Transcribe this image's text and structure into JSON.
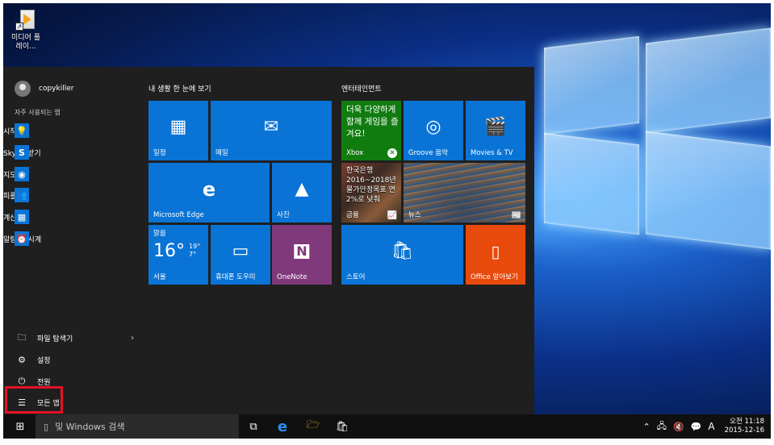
{
  "desktop": {
    "icon_label": "미디어 플레이..."
  },
  "start": {
    "user": "copykiller",
    "frequent_label": "자주 사용되는 앱",
    "apps": [
      {
        "icon": "bulb-icon",
        "label": "시작"
      },
      {
        "icon": "skype-icon",
        "label": "Skype 받기"
      },
      {
        "icon": "maps-icon",
        "label": "지도"
      },
      {
        "icon": "people-icon",
        "label": "피플"
      },
      {
        "icon": "calculator-icon",
        "label": "계산기"
      },
      {
        "icon": "alarm-icon",
        "label": "알람 및 시계"
      }
    ],
    "bottom": [
      {
        "icon": "folder-icon",
        "label": "파일 탐색기"
      },
      {
        "icon": "gear-icon",
        "label": "설정"
      },
      {
        "icon": "power-icon",
        "label": "전원"
      },
      {
        "icon": "all-apps-icon",
        "label": "모든 앱"
      }
    ],
    "group_life": "내 생활 한 눈에 보기",
    "group_ent": "엔터테인먼트",
    "tiles": {
      "calendar": "일정",
      "mail": "메일",
      "edge": "Microsoft Edge",
      "photos": "사진",
      "weather": {
        "condition": "맑음",
        "temp": "16°",
        "hi": "19°",
        "lo": "7°",
        "city": "서울"
      },
      "phone": "휴대폰 도우미",
      "onenote": "OneNote",
      "xbox_promo": "더욱 다양하게 함께 게임을 즐겨요!",
      "xbox": "Xbox",
      "groove": "Groove 음악",
      "movies": "Movies & TV",
      "finance_text": "한국은행 2016~2018년 물가안정목표 연 2%로 낮춰",
      "finance": "금융",
      "news": "뉴스",
      "store": "스토어",
      "office": "Office 알아보기"
    }
  },
  "taskbar": {
    "search_placeholder": "및 Windows 검색",
    "ime": "A",
    "time_line1": "오전 11:18",
    "time_line2": "2015-12-16"
  }
}
